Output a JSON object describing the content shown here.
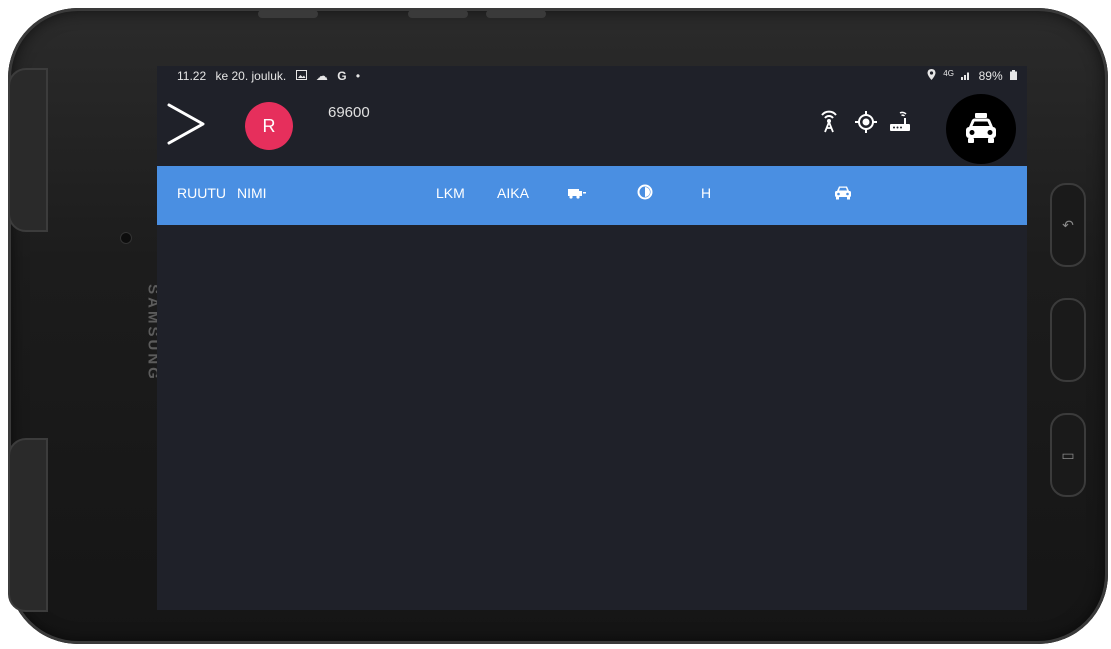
{
  "status_bar": {
    "time": "11.22",
    "date": "ke 20. jouluk.",
    "left_icons": [
      "image-icon",
      "cloud-icon",
      "google-icon",
      "dot-icon"
    ],
    "right_icons": [
      "location-icon",
      "signal-icon"
    ],
    "network": "4G",
    "battery": "89%"
  },
  "top_bar": {
    "avatar_letter": "R",
    "vehicle_id": "69600",
    "icons": [
      "antenna-icon",
      "gps-icon",
      "router-icon",
      "taxi-icon"
    ]
  },
  "table": {
    "columns": {
      "ruutu": "RUUTU",
      "nimi": "NIMI",
      "lkm": "LKM",
      "aika": "AIKA",
      "truck_icon": "truck-icon",
      "clock_icon": "clock-icon",
      "h": "H",
      "car_icon": "car-icon"
    },
    "rows": []
  },
  "device": {
    "brand": "SAMSUNG"
  },
  "colors": {
    "screen_bg": "#1f2129",
    "header_bg": "#4a8fe2",
    "avatar_bg": "#e62f5c",
    "taxi_button_bg": "#000000"
  }
}
